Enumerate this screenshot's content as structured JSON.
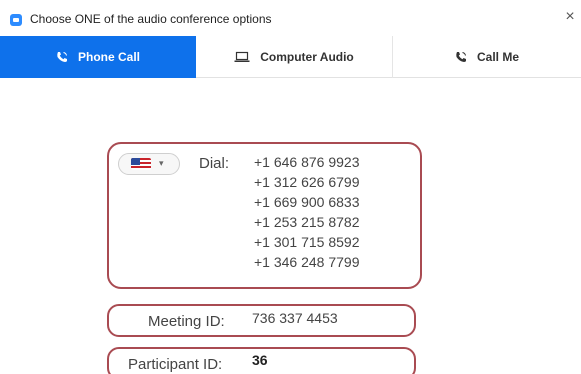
{
  "window": {
    "title": "Choose ONE of the audio conference options",
    "close_glyph": "×"
  },
  "tabs": [
    {
      "label": "Phone Call",
      "icon": "phone-icon",
      "active": true
    },
    {
      "label": "Computer Audio",
      "icon": "laptop-icon",
      "active": false
    },
    {
      "label": "Call Me",
      "icon": "phone-icon",
      "active": false
    }
  ],
  "dial": {
    "country_flag": "us-flag-icon",
    "caret": "▾",
    "label": "Dial:",
    "numbers": [
      "+1 646 876 9923",
      "+1 312 626 6799",
      "+1 669 900 6833",
      "+1 253 215 8782",
      "+1 301 715 8592",
      "+1 346 248 7799"
    ]
  },
  "meeting": {
    "label": "Meeting ID:",
    "value": "736 337 4453"
  },
  "participant": {
    "label": "Participant ID:",
    "value": "36"
  },
  "colors": {
    "accent": "#0e71eb",
    "highlight_border": "#a94b52"
  }
}
